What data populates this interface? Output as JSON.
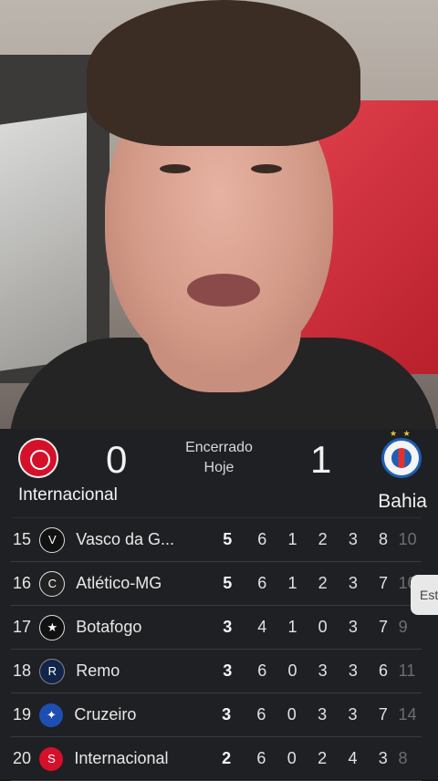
{
  "match": {
    "status": "Encerrado",
    "day": "Hoje",
    "home": {
      "name": "Internacional",
      "score": "0",
      "crest_icon": "internacional-crest-icon"
    },
    "away": {
      "name": "Bahia",
      "score": "1",
      "crest_icon": "bahia-crest-icon",
      "stars": "★ ★"
    }
  },
  "standings": [
    {
      "pos": "15",
      "team": "Vasco da G...",
      "pts": "5",
      "pj": "6",
      "v": "1",
      "e": "2",
      "d": "3",
      "gp": "8",
      "gc": "10",
      "crest": "V"
    },
    {
      "pos": "16",
      "team": "Atlético-MG",
      "pts": "5",
      "pj": "6",
      "v": "1",
      "e": "2",
      "d": "3",
      "gp": "7",
      "gc": "10",
      "crest": "C"
    },
    {
      "pos": "17",
      "team": "Botafogo",
      "pts": "3",
      "pj": "4",
      "v": "1",
      "e": "0",
      "d": "3",
      "gp": "7",
      "gc": "9",
      "crest": "★"
    },
    {
      "pos": "18",
      "team": "Remo",
      "pts": "3",
      "pj": "6",
      "v": "0",
      "e": "3",
      "d": "3",
      "gp": "6",
      "gc": "11",
      "crest": "R"
    },
    {
      "pos": "19",
      "team": "Cruzeiro",
      "pts": "3",
      "pj": "6",
      "v": "0",
      "e": "3",
      "d": "3",
      "gp": "7",
      "gc": "14",
      "crest": "✦"
    },
    {
      "pos": "20",
      "team": "Internacional",
      "pts": "2",
      "pj": "6",
      "v": "0",
      "e": "2",
      "d": "4",
      "gp": "3",
      "gc": "8",
      "crest": "S"
    }
  ],
  "side_tab": "Est",
  "colors": {
    "panel_bg": "#1f2023",
    "inter_red": "#d5102b",
    "bahia_blue": "#1c5fb5"
  }
}
